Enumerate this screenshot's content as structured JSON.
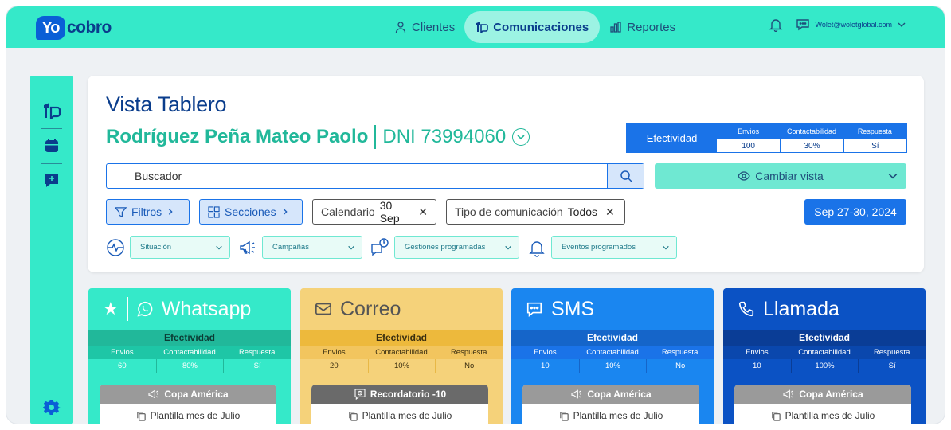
{
  "brand": {
    "logo_yo": "Yo",
    "logo_cobro": "cobro"
  },
  "nav": {
    "items": [
      {
        "label": "Clientes",
        "icon": "user-icon"
      },
      {
        "label": "Comunicaciones",
        "icon": "comunicaciones-icon",
        "active": true
      },
      {
        "label": "Reportes",
        "icon": "bar-chart-icon"
      }
    ]
  },
  "user": {
    "email": "Wolet@woletglobal.com"
  },
  "page": {
    "title": "Vista Tablero",
    "client_name": "Rodríguez Peña Mateo Paolo",
    "client_dni": "DNI 73994060"
  },
  "effectiveness": {
    "label": "Efectividad",
    "headers": [
      "Envios",
      "Contactabilidad",
      "Respuesta"
    ],
    "values": [
      "100",
      "30%",
      "Sí"
    ]
  },
  "search": {
    "placeholder": "Buscador"
  },
  "change_view": {
    "label": "Cambiar vista"
  },
  "chips": {
    "filtros": "Filtros",
    "secciones": "Secciones",
    "calendario_label": "Calendario",
    "calendario_value": "30 Sep",
    "tipo_label": "Tipo de comunicación",
    "tipo_value": "Todos"
  },
  "date_range": "Sep 27-30, 2024",
  "filters": {
    "situacion": "Situación",
    "campanas": "Campañas",
    "gestiones": "Gestiones programadas",
    "eventos": "Eventos programados"
  },
  "channels": [
    {
      "name": "Whatsapp",
      "eff_label": "Efectividad",
      "headers": [
        "Envios",
        "Contactabilidad",
        "Respuesta"
      ],
      "values": [
        "60",
        "80%",
        "Sí"
      ],
      "campaign": "Copa América",
      "template": "Plantilla mes de Julio"
    },
    {
      "name": "Correo",
      "eff_label": "Efectividad",
      "headers": [
        "Envios",
        "Contactabilidad",
        "Respuesta"
      ],
      "values": [
        "20",
        "10%",
        "No"
      ],
      "campaign": "Recordatorio -10",
      "template": "Plantilla mes de Julio"
    },
    {
      "name": "SMS",
      "eff_label": "Efectividad",
      "headers": [
        "Envios",
        "Contactabilidad",
        "Respuesta"
      ],
      "values": [
        "10",
        "10%",
        "No"
      ],
      "campaign": "Copa América",
      "template": "Plantilla mes de Julio"
    },
    {
      "name": "Llamada",
      "eff_label": "Efectividad",
      "headers": [
        "Envios",
        "Contactabilidad",
        "Respuesta"
      ],
      "values": [
        "10",
        "100%",
        "Sí"
      ],
      "campaign": "Copa América",
      "template": "Plantilla mes de Julio"
    }
  ]
}
